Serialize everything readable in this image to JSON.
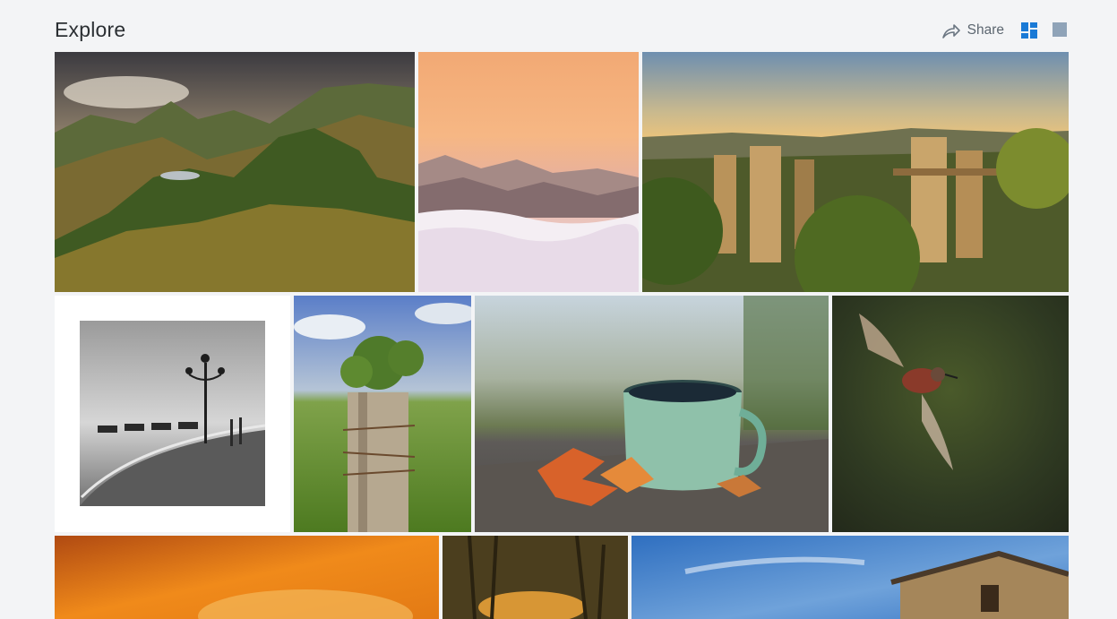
{
  "header": {
    "title": "Explore",
    "share_label": "Share",
    "share_icon": "share-arrow-icon",
    "view_mosaic_icon": "mosaic-grid-icon",
    "view_single_icon": "single-square-icon",
    "accent_color": "#1a7ad6",
    "inactive_icon_color": "#8fa3b8"
  },
  "photos": [
    {
      "subject": "mountain-landscape-sunset"
    },
    {
      "subject": "pink-sky-mountains-clouds"
    },
    {
      "subject": "sandstone-rocks-bridge-forest"
    },
    {
      "subject": "black-white-lamp-post-gondolas"
    },
    {
      "subject": "wooden-post-plant-meadow"
    },
    {
      "subject": "enamel-mug-autumn-leaves"
    },
    {
      "subject": "hummingbird-in-flight"
    },
    {
      "subject": "orange-blurred-abstract"
    },
    {
      "subject": "trees-sunset-reflection"
    },
    {
      "subject": "stone-building-blue-sky"
    }
  ]
}
